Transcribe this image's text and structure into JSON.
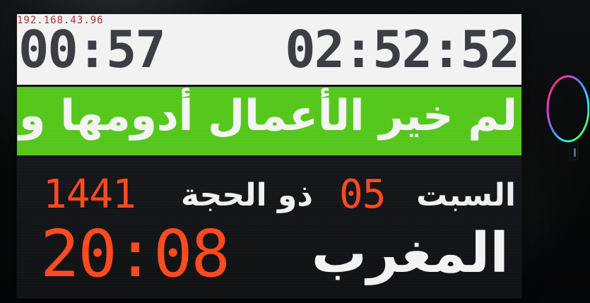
{
  "led_display": {
    "ip_address": "192.168.43.96",
    "current_time_left": "00:57",
    "current_time_right": "02:52:52",
    "message": "لم خير الأعمال أدومها وإن",
    "hijri_year": "1441",
    "hijri_month": "ذو الحجة",
    "hijri_day": "05",
    "weekday": "السبت",
    "prayer_time": "20:08",
    "prayer_name": "المغرب"
  },
  "colors": {
    "top_panel": "#f2f2f2",
    "message_band": "#55c71c",
    "accent_red": "#ff4a1f",
    "text_dark": "#3b3d43",
    "text_light": "#f0f0f0"
  },
  "icons": {
    "side_indicator": "rgb-ring-icon"
  }
}
